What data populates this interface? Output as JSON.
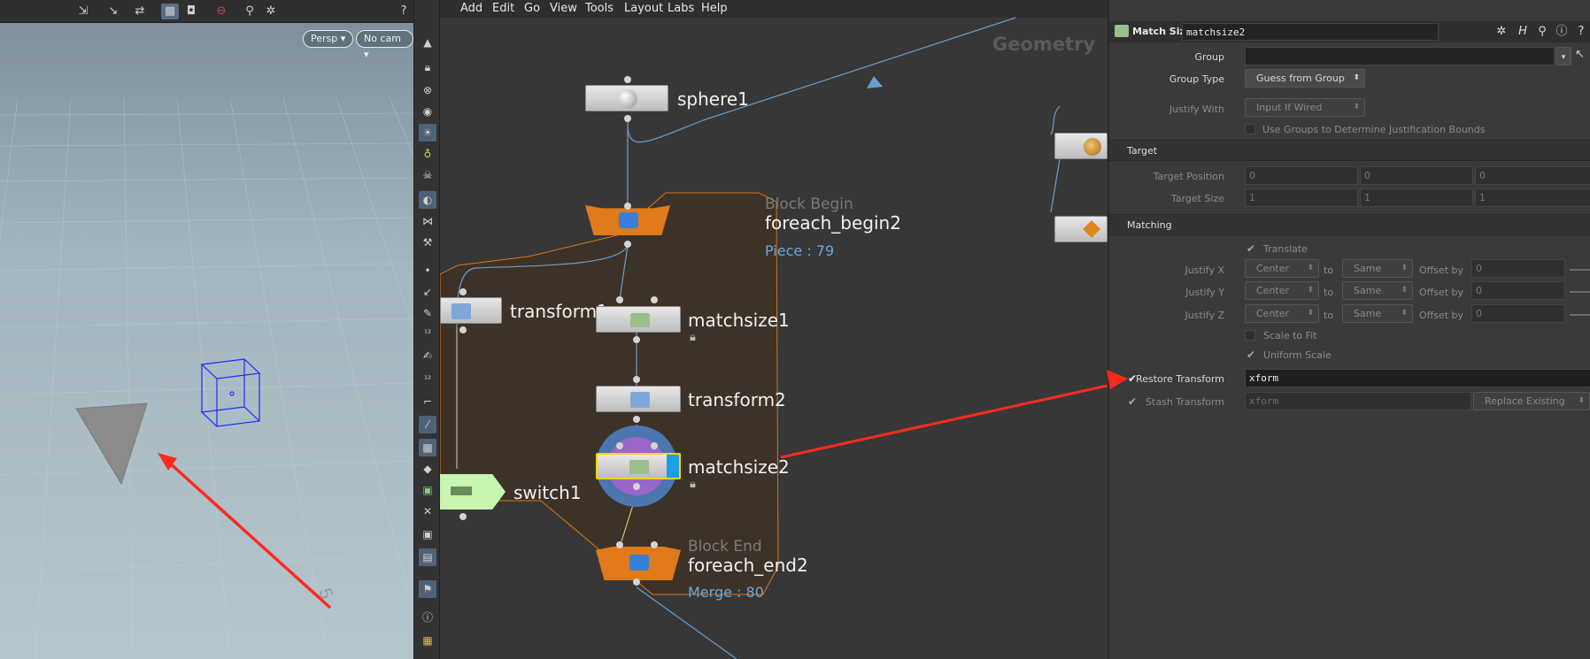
{
  "viewport": {
    "camera_pill": "Persp",
    "cam_pill": "No cam",
    "grid_number": "5",
    "toolbar_icons": [
      "select-transform-icon",
      "move-icon",
      "rotate-icon",
      "display-icon",
      "camera-icon",
      "no-entry-icon",
      "snap-icon",
      "settings-icon",
      "list-icon",
      "help-icon"
    ],
    "side_icons": [
      "arrow-up-icon",
      "lock-icon",
      "close-icon",
      "eye-icon",
      "light-icon",
      "bulb-icon",
      "skull-icon",
      "shading-icon",
      "pose-icon",
      "dot-icon",
      "tool-icon",
      "brush-icon",
      "number-icon",
      "tool-icon",
      "edit-icon",
      "corner-icon",
      "grid-icon",
      "palette-icon",
      "info-icon",
      "layout-icon"
    ]
  },
  "menu": {
    "items": [
      "Add",
      "Edit",
      "Go",
      "View",
      "Tools",
      "Layout",
      "Labs",
      "Help"
    ]
  },
  "network": {
    "context_label": "Geometry",
    "nodes": {
      "sphere1": {
        "name": "sphere1"
      },
      "foreach_begin2": {
        "sub": "Block Begin",
        "name": "foreach_begin2",
        "info": "Piece : 79"
      },
      "transform1": {
        "name": "transform1"
      },
      "matchsize1": {
        "name": "matchsize1"
      },
      "transform2": {
        "name": "transform2"
      },
      "matchsize2": {
        "name": "matchsize2"
      },
      "switch1": {
        "name": "switch1"
      },
      "foreach_end2": {
        "sub": "Block End",
        "name": "foreach_end2",
        "info": "Merge : 80"
      }
    }
  },
  "params": {
    "node_type": "Match Size",
    "node_name": "matchsize2",
    "group_label": "Group",
    "group_value": "",
    "group_type_label": "Group Type",
    "group_type_value": "Guess from Group",
    "justify_with_label": "Justify With",
    "justify_with_value": "Input If Wired",
    "use_groups_label": "Use Groups to Determine Justification Bounds",
    "target_section": "Target",
    "target_position_label": "Target Position",
    "target_position": [
      "0",
      "0",
      "0"
    ],
    "target_size_label": "Target Size",
    "target_size": [
      "1",
      "1",
      "1"
    ],
    "matching_section": "Matching",
    "translate_label": "Translate",
    "justify_rows": [
      {
        "label": "Justify X",
        "value": "Center",
        "to": "to",
        "same": "Same",
        "offset_label": "Offset by",
        "offset": "0"
      },
      {
        "label": "Justify Y",
        "value": "Center",
        "to": "to",
        "same": "Same",
        "offset_label": "Offset by",
        "offset": "0"
      },
      {
        "label": "Justify Z",
        "value": "Center",
        "to": "to",
        "same": "Same",
        "offset_label": "Offset by",
        "offset": "0"
      }
    ],
    "scale_to_fit_label": "Scale to Fit",
    "uniform_scale_label": "Uniform Scale",
    "restore_transform_label": "Restore Transform",
    "restore_transform_value": "xform",
    "stash_transform_label": "Stash Transform",
    "stash_transform_value": "xform",
    "replace_existing": "Replace Existing"
  },
  "colors": {
    "annotation_arrow": "#ff2a1e",
    "network_box": "#3c3128",
    "node_orange": "#e0791a",
    "wire": "#6b9cd0",
    "info_text": "#6fa6dc"
  }
}
